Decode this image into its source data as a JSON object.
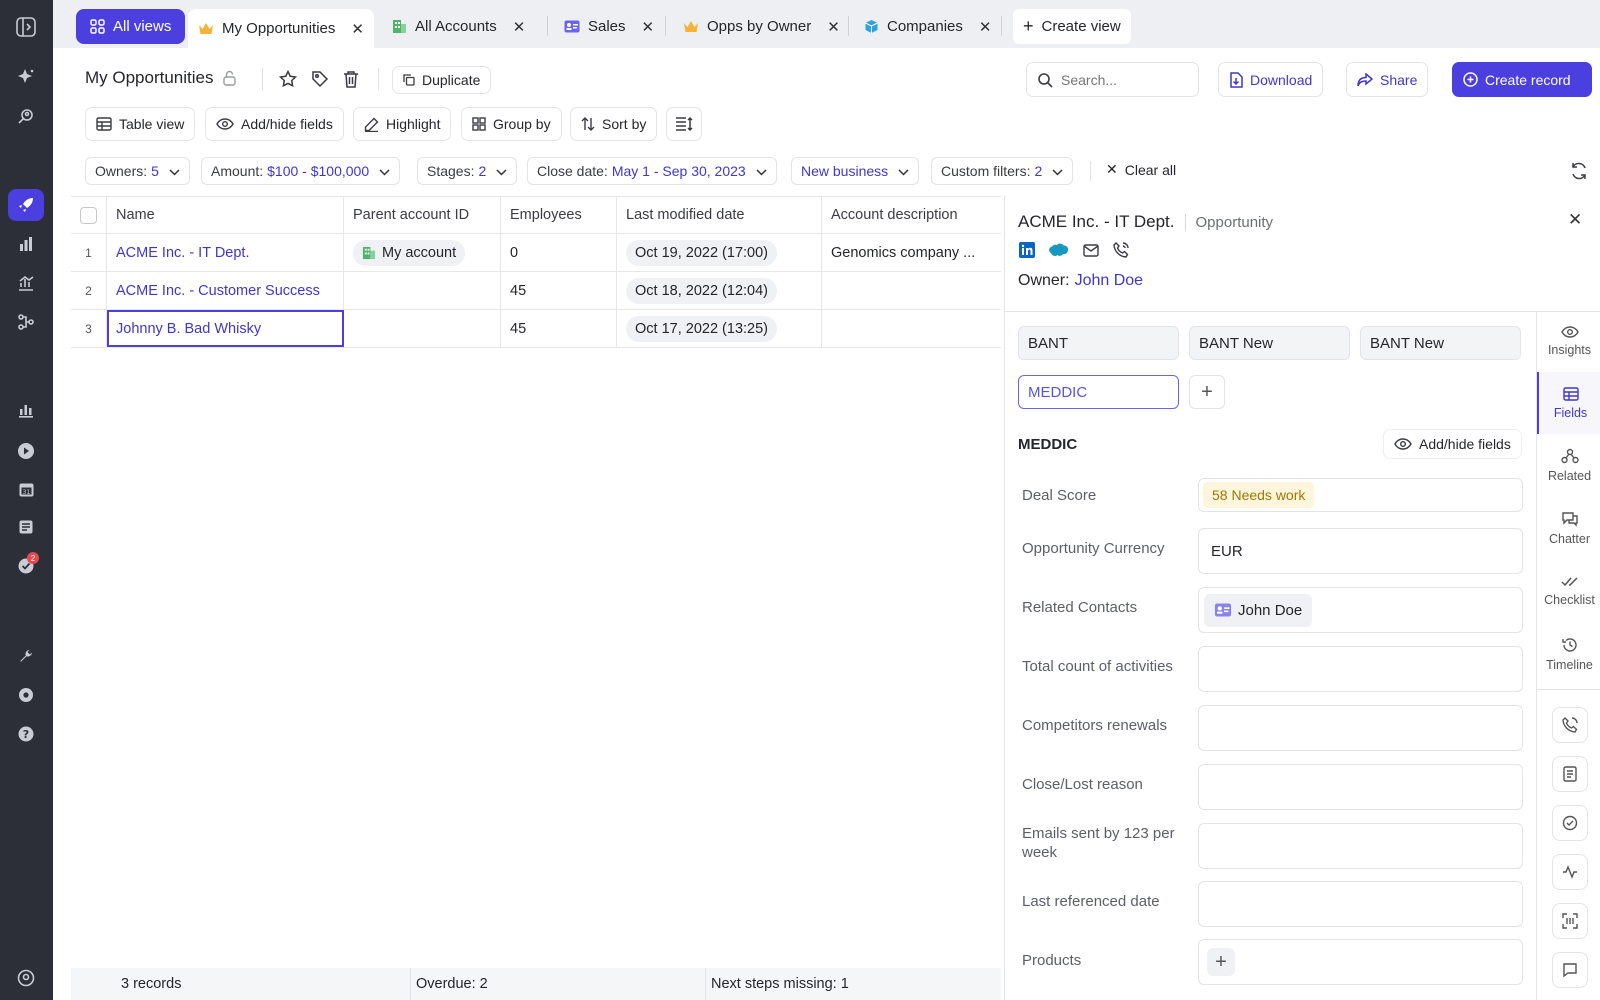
{
  "sidebar": {
    "items": [
      "sidebar-toggle-icon",
      "sparkle-icon",
      "search-user-icon",
      "rocket-icon",
      "building-chart-icon",
      "analytics-icon",
      "flow-icon",
      "bar-chart-icon",
      "play-icon",
      "calendar-icon",
      "notes-icon",
      "tasks-icon",
      "wrench-icon",
      "settings-icon",
      "help-icon",
      "profile-icon"
    ],
    "tasks_badge": "2"
  },
  "tabs": {
    "all_views": "All views",
    "items": [
      {
        "label": "My Opportunities",
        "icon": "crown-icon"
      },
      {
        "label": "All Accounts",
        "icon": "building-icon"
      },
      {
        "label": "Sales",
        "icon": "id-card-icon"
      },
      {
        "label": "Opps by Owner",
        "icon": "crown-icon"
      },
      {
        "label": "Companies",
        "icon": "cube-icon"
      }
    ],
    "create_view": "Create view"
  },
  "toolbar": {
    "title": "My Opportunities",
    "duplicate": "Duplicate",
    "search_placeholder": "Search...",
    "download": "Download",
    "share": "Share",
    "create_record": "Create record",
    "table_view": "Table view",
    "add_hide_fields": "Add/hide fields",
    "highlight": "Highlight",
    "group_by": "Group by",
    "sort_by": "Sort by"
  },
  "filters": {
    "owners_label": "Owners:",
    "owners_value": "5",
    "amount_label": "Amount:",
    "amount_value": "$100 - $100,000",
    "stages_label": "Stages:",
    "stages_value": "2",
    "close_label": "Close date:",
    "close_value": "May 1 - Sep 30, 2023",
    "new_business": "New business",
    "custom_label": "Custom filters:",
    "custom_value": "2",
    "clear_all": "Clear all"
  },
  "table": {
    "columns": [
      "Name",
      "Parent account ID",
      "Employees",
      "Last modified date",
      "Account description"
    ],
    "rows": [
      {
        "num": "1",
        "name": "ACME Inc. - IT Dept.",
        "parent": "My account",
        "employees": "0",
        "modified": "Oct 19, 2022 (17:00)",
        "description": "Genomics company ..."
      },
      {
        "num": "2",
        "name": "ACME Inc. - Customer Success",
        "parent": "",
        "employees": "45",
        "modified": "Oct 18, 2022 (12:04)",
        "description": ""
      },
      {
        "num": "3",
        "name": "Johnny B. Bad Whisky",
        "parent": "",
        "employees": "45",
        "modified": "Oct 17, 2022 (13:25)",
        "description": ""
      }
    ]
  },
  "footer": {
    "records": "3 records",
    "overdue": "Overdue: 2",
    "next_steps": "Next steps missing: 1"
  },
  "panel": {
    "title": "ACME Inc. - IT Dept.",
    "type": "Opportunity",
    "owner_label": "Owner:",
    "owner_value": "John Doe",
    "frameworks": [
      "BANT",
      "BANT New",
      "BANT New"
    ],
    "active_framework": "MEDDIC",
    "section_title": "MEDDIC",
    "add_hide_fields": "Add/hide fields",
    "fields": {
      "deal_score_label": "Deal Score",
      "deal_score_value": "58 Needs work",
      "currency_label": "Opportunity Currency",
      "currency_value": "EUR",
      "contacts_label": "Related Contacts",
      "contacts_value": "John Doe",
      "activities_label": "Total count of activities",
      "competitors_label": "Competitors renewals",
      "lost_reason_label": "Close/Lost reason",
      "emails_label": "Emails sent by 123 per week",
      "last_ref_label": "Last referenced date",
      "products_label": "Products"
    },
    "rail": [
      "Insights",
      "Fields",
      "Related",
      "Chatter",
      "Checklist",
      "Timeline"
    ],
    "colors": {
      "accent": "#4b3fe0",
      "link": "#3f37c9",
      "badge_bg": "#fdf6dc",
      "badge_text": "#a07800"
    }
  }
}
